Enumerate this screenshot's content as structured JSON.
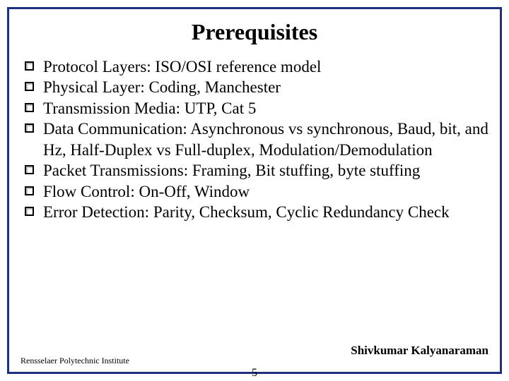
{
  "slide": {
    "title": "Prerequisites",
    "bullets": [
      "Protocol Layers: ISO/OSI reference model",
      "Physical Layer: Coding, Manchester",
      "Transmission Media: UTP, Cat 5",
      "Data Communication: Asynchronous vs synchronous, Baud, bit, and Hz, Half-Duplex vs Full-duplex, Modulation/Demodulation",
      "Packet Transmissions: Framing, Bit stuffing, byte stuffing",
      "Flow Control: On-Off, Window",
      "Error Detection: Parity, Checksum, Cyclic Redundancy Check"
    ],
    "footer_left": "Rensselaer Polytechnic Institute",
    "footer_right": "Shivkumar Kalyanaraman",
    "page_number": "5"
  }
}
